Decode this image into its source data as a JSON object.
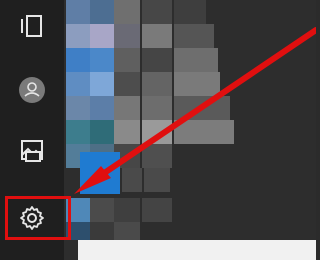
{
  "start_menu": {
    "rail_items": [
      {
        "name": "expand",
        "icon": "panel-toggle-icon"
      },
      {
        "name": "account",
        "icon": "user-icon"
      },
      {
        "name": "pictures",
        "icon": "pictures-icon"
      },
      {
        "name": "settings",
        "icon": "gear-icon"
      }
    ]
  },
  "annotation": {
    "highlight_color": "#e00f0f",
    "arrow_color": "#e00f0f"
  }
}
